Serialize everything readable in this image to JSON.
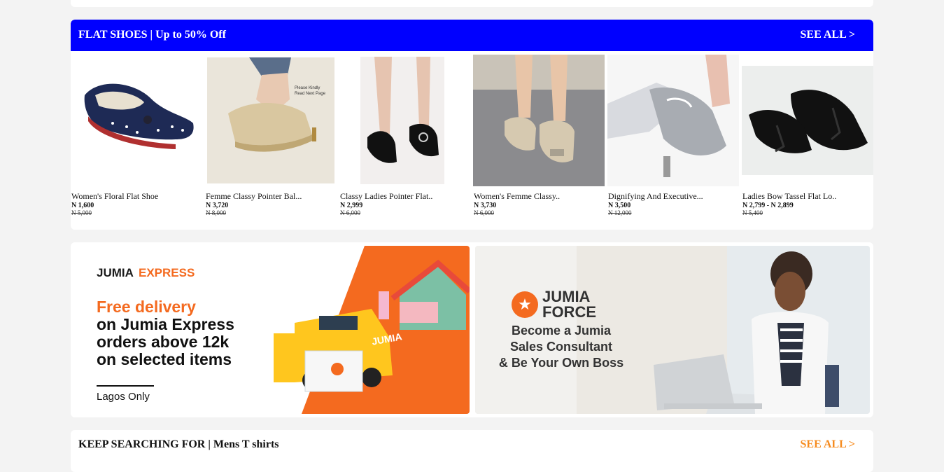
{
  "flat_shoes": {
    "title": "FLAT SHOES | Up to 50% Off",
    "see_all": "SEE ALL >",
    "header_color": "#0000ff",
    "products": [
      {
        "name": "Women's Floral Flat Shoe",
        "price": "N 1,600",
        "old_price": "N 5,000"
      },
      {
        "name": "Femme Classy Pointer Bal...",
        "price": "N 3,720",
        "old_price": "N 8,000"
      },
      {
        "name": "Classy Ladies Pointer Flat..",
        "price": "N 2,999",
        "old_price": "N 6,000"
      },
      {
        "name": "Women's Femme Classy..",
        "price": "N 3,730",
        "old_price": "N 6,000"
      },
      {
        "name": "Dignifying And Executive...",
        "price": "N 3,500",
        "old_price": "N 12,000"
      },
      {
        "name": "Ladies Bow Tassel Flat Lo..",
        "price": "N 2,799 - N 2,899",
        "old_price": "N 5,400"
      }
    ]
  },
  "banners": {
    "express": {
      "brand": "JUMIA",
      "brand_suffix": "EXPRESS",
      "headline": "Free delivery",
      "line1": "on Jumia Express",
      "line2": "orders above 12k",
      "line3": "on selected items",
      "note": "Lagos Only",
      "truck_label": "JUMIA"
    },
    "force": {
      "brand_line1": "JUMIA",
      "brand_line2": "FORCE",
      "line1": "Become a Jumia",
      "line2": "Sales Consultant",
      "line3": "& Be Your Own Boss"
    }
  },
  "keep_searching": {
    "title": "KEEP SEARCHING FOR | Mens T shirts",
    "see_all": "SEE ALL >",
    "accent": "#f68b1e"
  }
}
